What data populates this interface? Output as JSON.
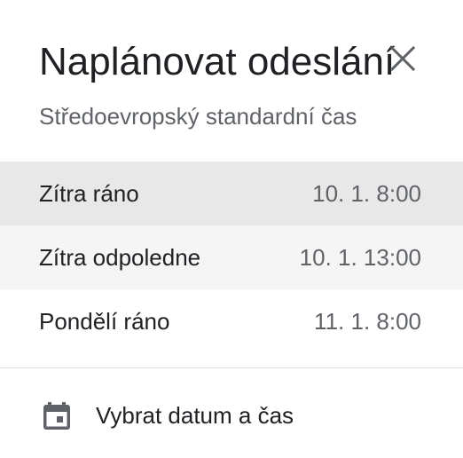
{
  "dialog": {
    "title": "Naplánovat odeslání",
    "subtitle": "Středoevropský standardní čas",
    "close_icon": "close-icon"
  },
  "options": [
    {
      "label": "Zítra ráno",
      "time": "10. 1. 8:00"
    },
    {
      "label": "Zítra odpoledne",
      "time": "10. 1. 13:00"
    },
    {
      "label": "Pondělí ráno",
      "time": "11. 1. 8:00"
    }
  ],
  "pick": {
    "icon": "calendar-icon",
    "label": "Vybrat datum a čas"
  },
  "colors": {
    "selected_row": "#e8e8e8",
    "hover_row": "#f5f5f5",
    "text": "#202124",
    "secondary_text": "#5f6368",
    "divider": "#dadce0"
  }
}
